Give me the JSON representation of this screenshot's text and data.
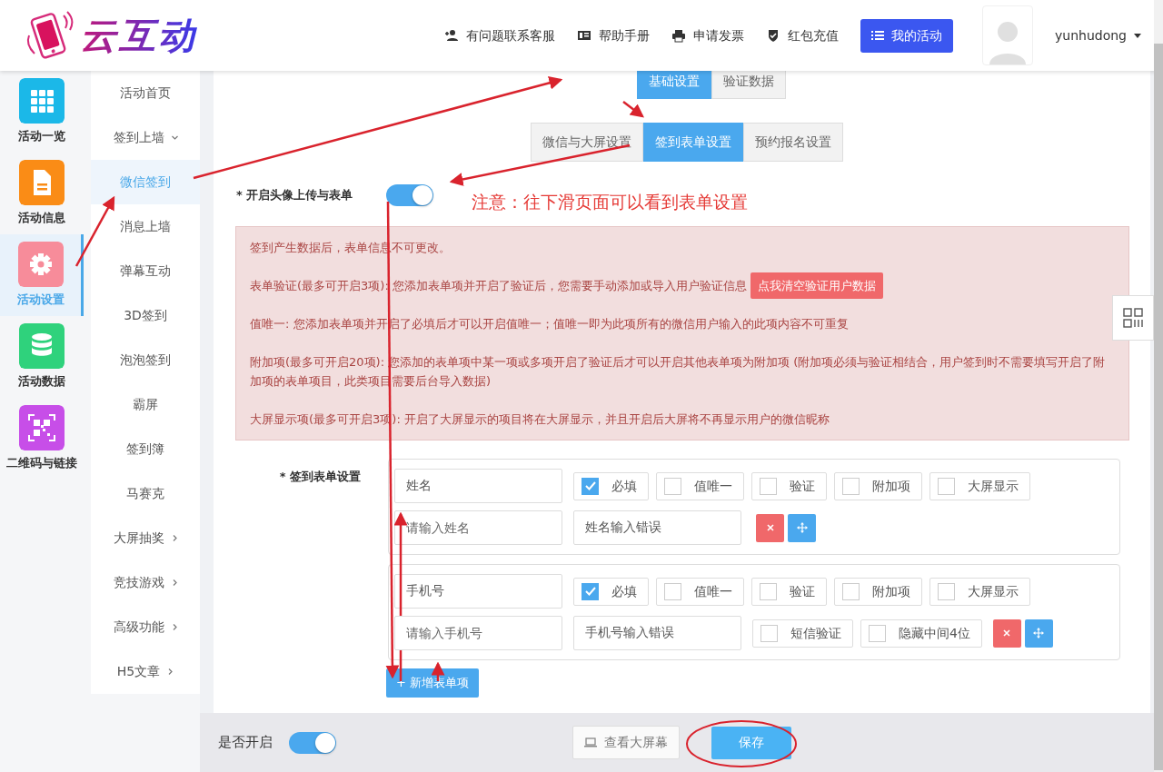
{
  "header": {
    "logo_text": "云互动",
    "links": [
      {
        "kind": "user-plus",
        "label": "有问题联系客服"
      },
      {
        "kind": "book",
        "label": "帮助手册"
      },
      {
        "kind": "printer",
        "label": "申请发票"
      },
      {
        "kind": "shield",
        "label": "红包充值"
      }
    ],
    "primary_button": "我的活动",
    "username": "yunhudong"
  },
  "icon_sidebar": [
    {
      "label": "活动一览",
      "color": "#1bb8e8",
      "selected": false
    },
    {
      "label": "活动信息",
      "color": "#fa8c16",
      "selected": false
    },
    {
      "label": "活动设置",
      "color": "#f78c9a",
      "selected": true
    },
    {
      "label": "活动数据",
      "color": "#2fd27c",
      "selected": false
    },
    {
      "label": "二维码与链接",
      "color": "#c74ee8",
      "selected": false
    }
  ],
  "submenu": [
    {
      "label": "活动首页",
      "selected": false
    },
    {
      "label": "签到上墙",
      "selected": false,
      "expanded": true,
      "children": [
        {
          "label": "微信签到",
          "selected": true
        },
        {
          "label": "消息上墙",
          "selected": false
        },
        {
          "label": "弹幕互动",
          "selected": false
        },
        {
          "label": "3D签到",
          "selected": false
        },
        {
          "label": "泡泡签到",
          "selected": false
        },
        {
          "label": "霸屏",
          "selected": false
        },
        {
          "label": "签到簿",
          "selected": false
        },
        {
          "label": "马赛克",
          "selected": false
        }
      ]
    },
    {
      "label": "大屏抽奖",
      "selected": false,
      "expanded": false
    },
    {
      "label": "竞技游戏",
      "selected": false,
      "expanded": false
    },
    {
      "label": "高级功能",
      "selected": false,
      "expanded": false
    },
    {
      "label": "H5文章",
      "selected": false,
      "expanded": false
    }
  ],
  "tabs": [
    {
      "label": "基础设置",
      "selected": true
    },
    {
      "label": "验证数据",
      "selected": false
    }
  ],
  "subtabs": [
    {
      "label": "微信与大屏设置",
      "selected": false
    },
    {
      "label": "签到表单设置",
      "selected": true
    },
    {
      "label": "预约报名设置",
      "selected": false
    }
  ],
  "avatar_switch": {
    "label": "* 开启头像上传与表单",
    "on": true
  },
  "notice": [
    {
      "text": "签到产生数据后，表单信息不可更改。"
    },
    {
      "text": "表单验证(最多可开启3项): 您添加表单项并开启了验证后，您需要手动添加或导入用户验证信息",
      "button": "点我清空验证用户数据"
    },
    {
      "text": "值唯一: 您添加表单项并开启了必填后才可以开启值唯一；值唯一即为此项所有的微信用户输入的此项内容不可重复"
    },
    {
      "text": "附加项(最多可开启20项): 您添加的表单项中某一项或多项开启了验证后才可以开启其他表单项为附加项 (附加项必须与验证相结合，用户签到时不需要填写开启了附加项的表单项目，此类项目需要后台导入数据)"
    },
    {
      "text": "大屏显示项(最多可开启3项): 开启了大屏显示的项目将在大屏显示，并且开启后大屏将不再显示用户的微信昵称"
    }
  ],
  "form": {
    "label": "* 签到表单设置",
    "items": [
      {
        "name": "姓名",
        "placeholder": "请输入姓名",
        "error_text": "姓名输入错误",
        "options": [
          {
            "label": "必填",
            "checked": true
          },
          {
            "label": "值唯一",
            "checked": false
          },
          {
            "label": "验证",
            "checked": false
          },
          {
            "label": "附加项",
            "checked": false
          },
          {
            "label": "大屏显示",
            "checked": false
          }
        ]
      },
      {
        "name": "手机号",
        "placeholder": "请输入手机号",
        "error_text": "手机号输入错误",
        "options": [
          {
            "label": "必填",
            "checked": true
          },
          {
            "label": "值唯一",
            "checked": false
          },
          {
            "label": "验证",
            "checked": false
          },
          {
            "label": "附加项",
            "checked": false
          },
          {
            "label": "大屏显示",
            "checked": false
          }
        ],
        "extra_options": [
          {
            "label": "短信验证",
            "checked": false
          },
          {
            "label": "隐藏中间4位",
            "checked": false
          }
        ]
      }
    ],
    "add_button": "+ 新增表单项"
  },
  "footer": {
    "label": "是否开启",
    "on": true,
    "preview_button": "查看大屏幕",
    "save_button": "保存"
  },
  "annotation": {
    "note": "注意：往下滑页面可以看到表单设置"
  }
}
